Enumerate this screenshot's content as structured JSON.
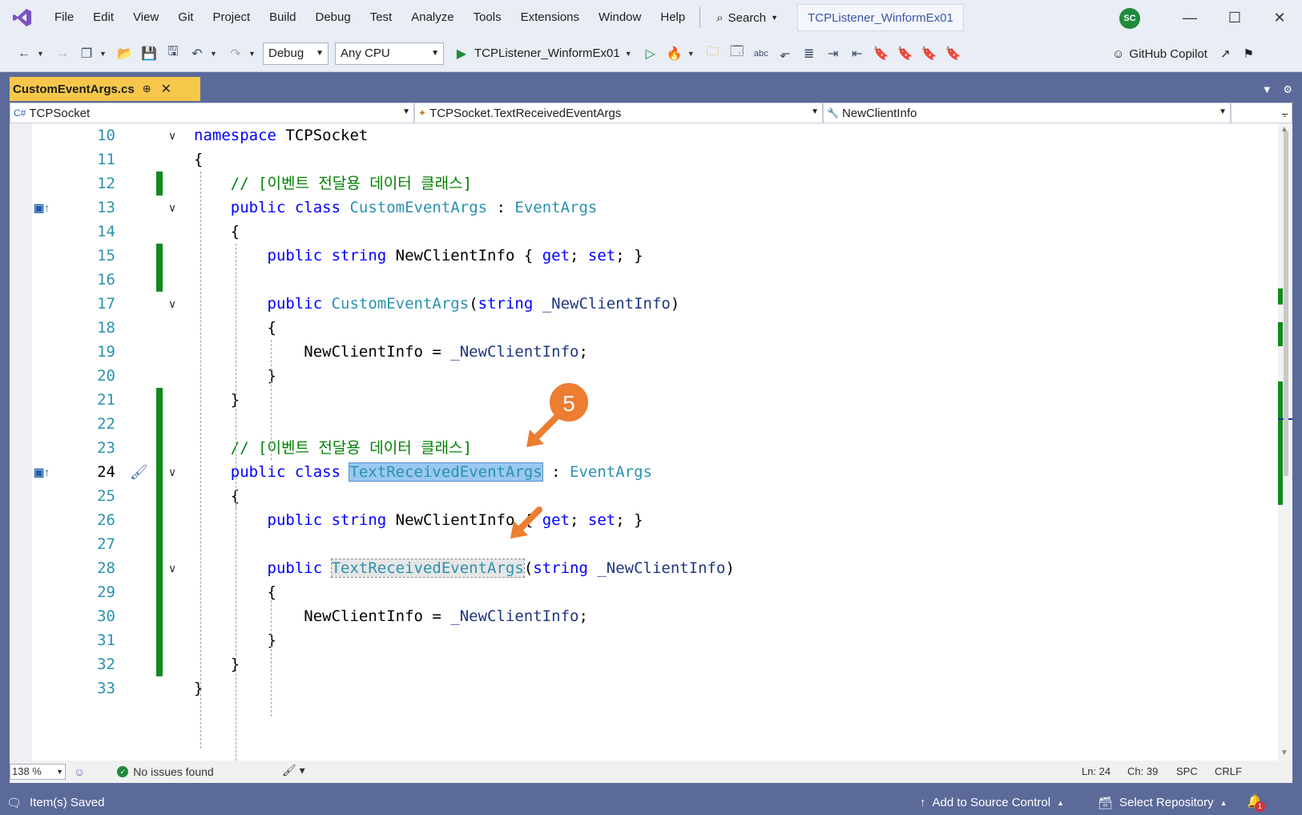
{
  "menu": [
    "File",
    "Edit",
    "View",
    "Git",
    "Project",
    "Build",
    "Debug",
    "Test",
    "Analyze",
    "Tools",
    "Extensions",
    "Window",
    "Help"
  ],
  "search_label": "Search",
  "solution_name": "TCPListener_WinformEx01",
  "user_initials": "SC",
  "toolbar": {
    "config": "Debug",
    "platform": "Any CPU",
    "run_target": "TCPListener_WinformEx01",
    "copilot_label": "GitHub Copilot"
  },
  "document_tab": {
    "title": "CustomEventArgs.cs",
    "pin_glyph": "⊕",
    "close_glyph": "✕"
  },
  "navbar": {
    "project": "TCPSocket",
    "type": "TCPSocket.TextReceivedEventArgs",
    "member": "NewClientInfo"
  },
  "code_lines": [
    {
      "no": "10",
      "segments": [
        {
          "t": "namespace ",
          "c": "kw"
        },
        {
          "t": "TCPSocket",
          "c": ""
        }
      ]
    },
    {
      "no": "11",
      "segments": [
        {
          "t": "{",
          "c": ""
        }
      ]
    },
    {
      "no": "12",
      "segments": [
        {
          "t": "    // [이벤트 전달용 데이터 클래스]",
          "c": "cm"
        }
      ]
    },
    {
      "no": "13",
      "segments": [
        {
          "t": "    public ",
          "c": "kw"
        },
        {
          "t": "class ",
          "c": "kw"
        },
        {
          "t": "CustomEventArgs",
          "c": "cls"
        },
        {
          "t": " : ",
          "c": ""
        },
        {
          "t": "EventArgs",
          "c": "cls"
        }
      ]
    },
    {
      "no": "14",
      "segments": [
        {
          "t": "    {",
          "c": ""
        }
      ]
    },
    {
      "no": "15",
      "segments": [
        {
          "t": "        public ",
          "c": "kw"
        },
        {
          "t": "string ",
          "c": "kw"
        },
        {
          "t": "NewClientInfo { ",
          "c": ""
        },
        {
          "t": "get",
          "c": "kw"
        },
        {
          "t": "; ",
          "c": ""
        },
        {
          "t": "set",
          "c": "kw"
        },
        {
          "t": "; }",
          "c": ""
        }
      ]
    },
    {
      "no": "16",
      "segments": []
    },
    {
      "no": "17",
      "segments": [
        {
          "t": "        public ",
          "c": "kw"
        },
        {
          "t": "CustomEventArgs",
          "c": "cls"
        },
        {
          "t": "(",
          "c": ""
        },
        {
          "t": "string ",
          "c": "kw"
        },
        {
          "t": "_NewClientInfo",
          "c": "ident"
        },
        {
          "t": ")",
          "c": ""
        }
      ]
    },
    {
      "no": "18",
      "segments": [
        {
          "t": "        {",
          "c": ""
        }
      ]
    },
    {
      "no": "19",
      "segments": [
        {
          "t": "            NewClientInfo = ",
          "c": ""
        },
        {
          "t": "_NewClientInfo",
          "c": "ident"
        },
        {
          "t": ";",
          "c": ""
        }
      ]
    },
    {
      "no": "20",
      "segments": [
        {
          "t": "        }",
          "c": ""
        }
      ]
    },
    {
      "no": "21",
      "segments": [
        {
          "t": "    }",
          "c": ""
        }
      ]
    },
    {
      "no": "22",
      "segments": []
    },
    {
      "no": "23",
      "segments": [
        {
          "t": "    // [이벤트 전달용 데이터 클래스]",
          "c": "cm"
        }
      ]
    },
    {
      "no": "24",
      "segments": [
        {
          "t": "    public ",
          "c": "kw"
        },
        {
          "t": "class ",
          "c": "kw"
        },
        {
          "t": "TextReceivedEventArgs",
          "c": "cls sel"
        },
        {
          "t": " : ",
          "c": ""
        },
        {
          "t": "EventArgs",
          "c": "cls"
        }
      ]
    },
    {
      "no": "25",
      "segments": [
        {
          "t": "    {",
          "c": ""
        }
      ]
    },
    {
      "no": "26",
      "segments": [
        {
          "t": "        public ",
          "c": "kw"
        },
        {
          "t": "string ",
          "c": "kw"
        },
        {
          "t": "NewClientInfo { ",
          "c": ""
        },
        {
          "t": "get",
          "c": "kw"
        },
        {
          "t": "; ",
          "c": ""
        },
        {
          "t": "set",
          "c": "kw"
        },
        {
          "t": "; }",
          "c": ""
        }
      ]
    },
    {
      "no": "27",
      "segments": []
    },
    {
      "no": "28",
      "segments": [
        {
          "t": "        public ",
          "c": "kw"
        },
        {
          "t": "TextReceivedEventArgs",
          "c": "cls ref-hl"
        },
        {
          "t": "(",
          "c": ""
        },
        {
          "t": "string ",
          "c": "kw"
        },
        {
          "t": "_NewClientInfo",
          "c": "ident"
        },
        {
          "t": ")",
          "c": ""
        }
      ]
    },
    {
      "no": "29",
      "segments": [
        {
          "t": "        {",
          "c": ""
        }
      ]
    },
    {
      "no": "30",
      "segments": [
        {
          "t": "            NewClientInfo = ",
          "c": ""
        },
        {
          "t": "_NewClientInfo",
          "c": "ident"
        },
        {
          "t": ";",
          "c": ""
        }
      ]
    },
    {
      "no": "31",
      "segments": [
        {
          "t": "        }",
          "c": ""
        }
      ]
    },
    {
      "no": "32",
      "segments": [
        {
          "t": "    }",
          "c": ""
        }
      ]
    },
    {
      "no": "33",
      "segments": [
        {
          "t": "}",
          "c": ""
        }
      ]
    }
  ],
  "current_line": "24",
  "annotation_step": "5",
  "editor_status": {
    "zoom": "138 %",
    "issues": "No issues found",
    "line": "Ln: 24",
    "char": "Ch: 39",
    "whitespace": "SPC",
    "line_ending": "CRLF"
  },
  "statusbar": {
    "message": "Item(s) Saved",
    "source_control": "Add to Source Control",
    "repository": "Select Repository",
    "notification_count": "1"
  },
  "colors": {
    "accent_tab": "#f6c74a",
    "chrome_blue": "#5b6a99",
    "change_green": "#108a1b",
    "annotation_orange": "#ed7d31"
  }
}
